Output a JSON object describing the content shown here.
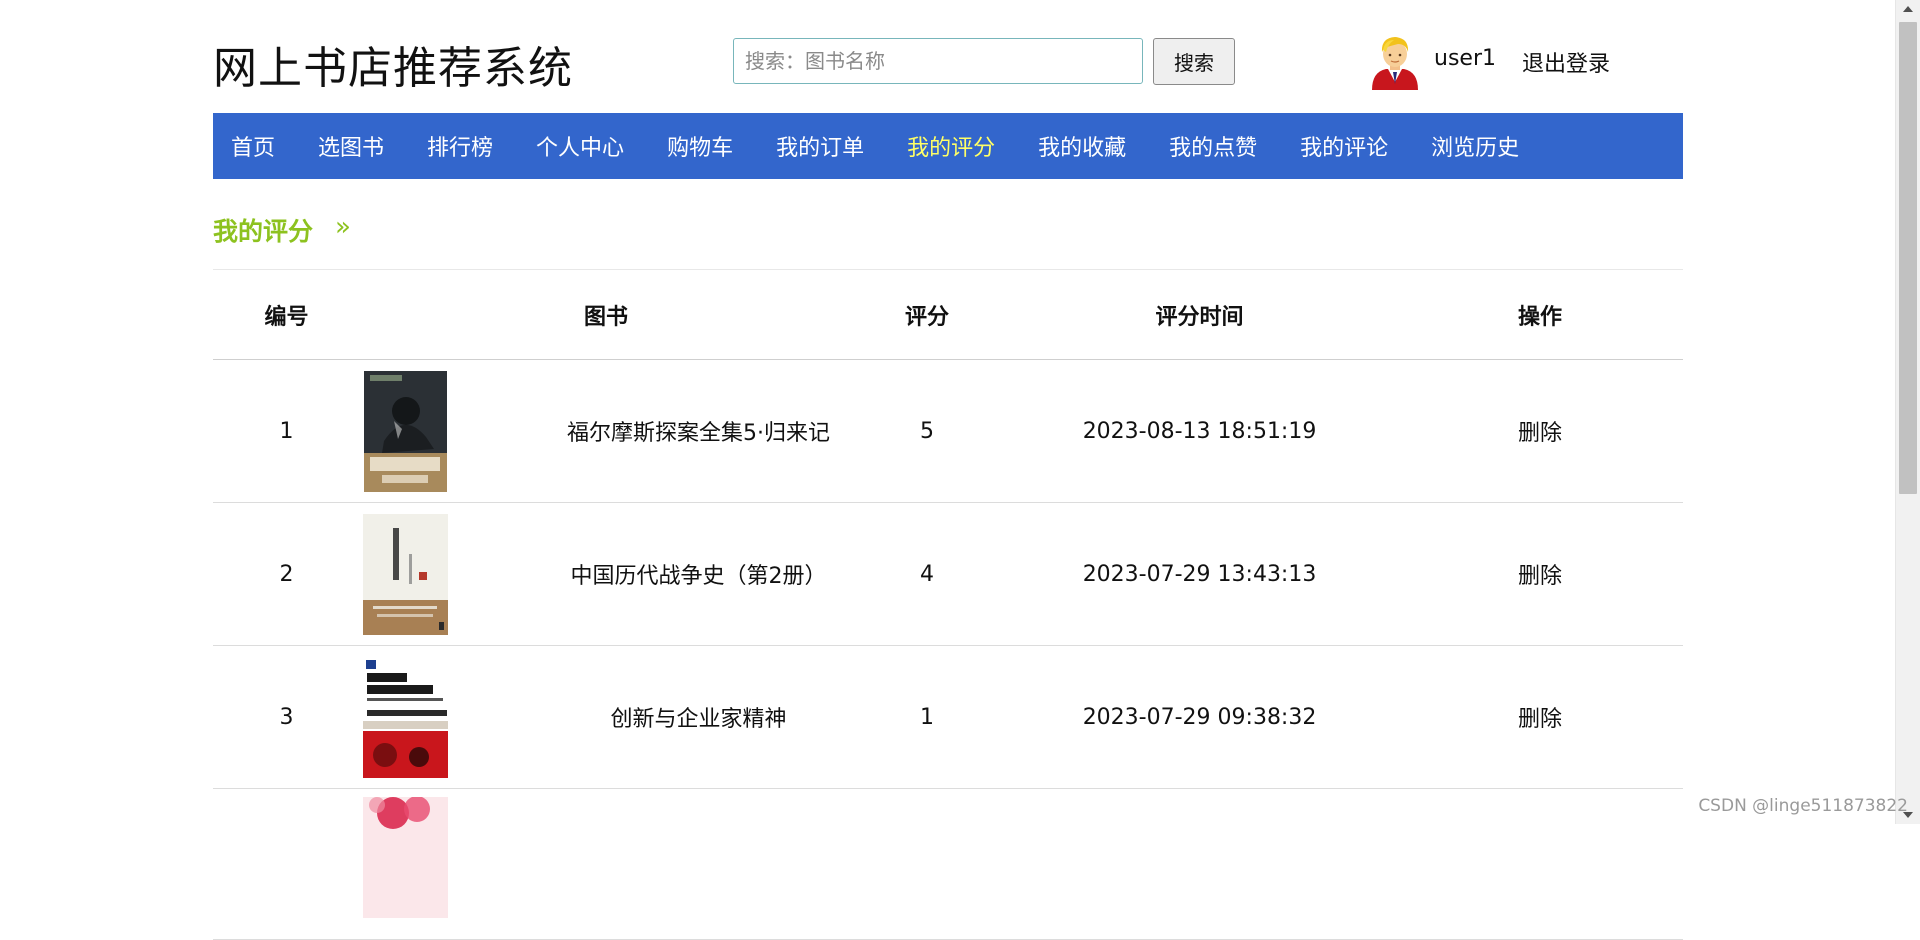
{
  "header": {
    "site_title": "网上书店推荐系统",
    "search": {
      "placeholder": "搜索：图书名称",
      "value": "",
      "button_label": "搜索"
    },
    "user": {
      "name": "user1",
      "logout_label": "退出登录"
    }
  },
  "nav": {
    "items": [
      "首页",
      "选图书",
      "排行榜",
      "个人中心",
      "购物车",
      "我的订单",
      "我的评分",
      "我的收藏",
      "我的点赞",
      "我的评论",
      "浏览历史"
    ],
    "active_index": 6,
    "background": "#3366cc",
    "active_color": "#ffff66"
  },
  "section": {
    "title": "我的评分",
    "arrow": "»",
    "accent": "#8dc21f"
  },
  "table": {
    "headers": [
      "编号",
      "图书",
      "评分",
      "评分时间",
      "操作"
    ],
    "rows": [
      {
        "id": "1",
        "title": "福尔摩斯探案全集5·归来记",
        "rating": "5",
        "time": "2023-08-13 18:51:19",
        "action": "删除"
      },
      {
        "id": "2",
        "title": "中国历代战争史（第2册）",
        "rating": "4",
        "time": "2023-07-29 13:43:13",
        "action": "删除"
      },
      {
        "id": "3",
        "title": "创新与企业家精神",
        "rating": "1",
        "time": "2023-07-29 09:38:32",
        "action": "删除"
      },
      {
        "id": "",
        "title": "",
        "rating": "",
        "time": "",
        "action": ""
      }
    ]
  },
  "watermark": "CSDN @linge511873822"
}
